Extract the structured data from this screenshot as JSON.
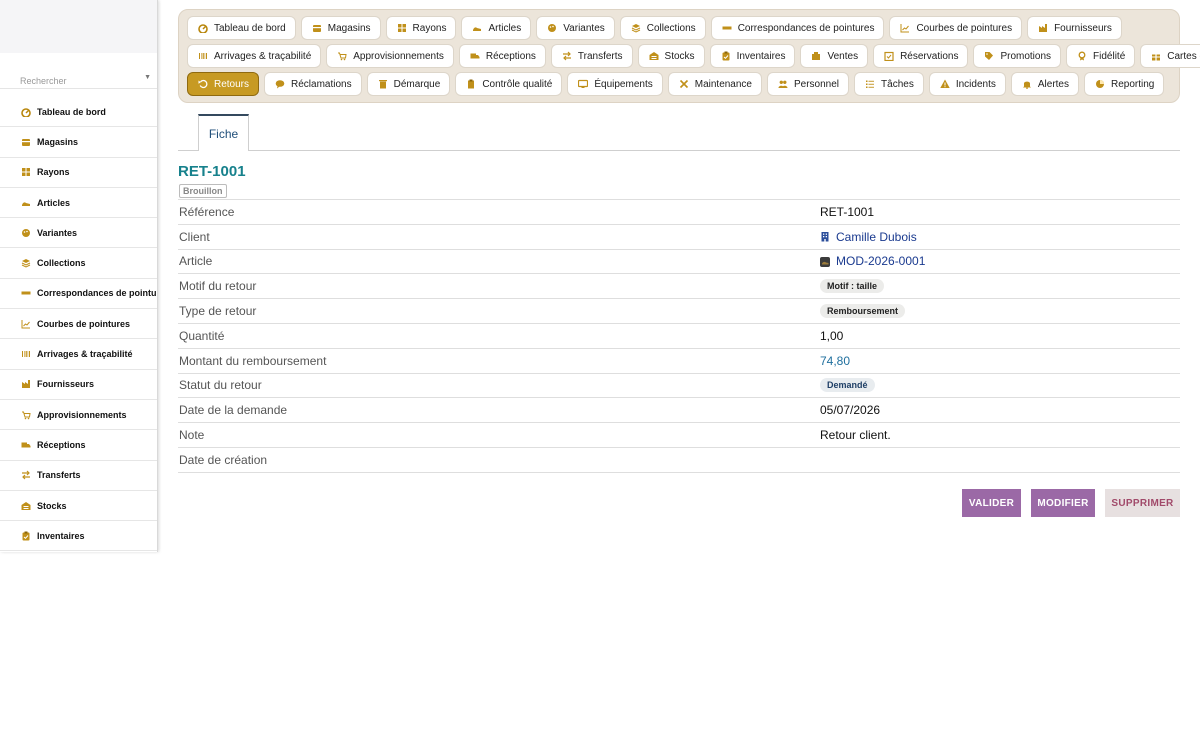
{
  "sidebar": {
    "search_placeholder": "Rechercher",
    "items": [
      {
        "label": "Tableau de bord",
        "icon": "dashboard-icon"
      },
      {
        "label": "Magasins",
        "icon": "store-icon"
      },
      {
        "label": "Rayons",
        "icon": "grid-icon"
      },
      {
        "label": "Articles",
        "icon": "shoe-icon"
      },
      {
        "label": "Variantes",
        "icon": "palette-icon"
      },
      {
        "label": "Collections",
        "icon": "layers-icon"
      },
      {
        "label": "Correspondances de pointures",
        "icon": "ruler-icon"
      },
      {
        "label": "Courbes de pointures",
        "icon": "chart-icon"
      },
      {
        "label": "Arrivages & traçabilité",
        "icon": "barcode-icon"
      },
      {
        "label": "Fournisseurs",
        "icon": "factory-icon"
      },
      {
        "label": "Approvisionnements",
        "icon": "cart-icon"
      },
      {
        "label": "Réceptions",
        "icon": "truck-icon"
      },
      {
        "label": "Transferts",
        "icon": "transfer-icon"
      },
      {
        "label": "Stocks",
        "icon": "warehouse-icon"
      },
      {
        "label": "Inventaires",
        "icon": "clipboard-icon"
      }
    ]
  },
  "topnav": {
    "rows": [
      [
        {
          "label": "Tableau de bord",
          "icon": "dashboard-icon"
        },
        {
          "label": "Magasins",
          "icon": "store-icon"
        },
        {
          "label": "Rayons",
          "icon": "grid-icon"
        },
        {
          "label": "Articles",
          "icon": "shoe-icon"
        },
        {
          "label": "Variantes",
          "icon": "palette-icon"
        },
        {
          "label": "Collections",
          "icon": "layers-icon"
        },
        {
          "label": "Correspondances de pointures",
          "icon": "ruler-icon"
        },
        {
          "label": "Courbes de pointures",
          "icon": "chart-icon"
        },
        {
          "label": "Fournisseurs",
          "icon": "factory-icon"
        }
      ],
      [
        {
          "label": "Arrivages & traçabilité",
          "icon": "barcode-icon"
        },
        {
          "label": "Approvisionnements",
          "icon": "cart-icon"
        },
        {
          "label": "Réceptions",
          "icon": "truck-icon"
        },
        {
          "label": "Transferts",
          "icon": "transfer-icon"
        },
        {
          "label": "Stocks",
          "icon": "warehouse-icon"
        },
        {
          "label": "Inventaires",
          "icon": "clipboard-icon"
        },
        {
          "label": "Ventes",
          "icon": "sales-icon"
        },
        {
          "label": "Réservations",
          "icon": "reservation-icon"
        },
        {
          "label": "Promotions",
          "icon": "tag-icon"
        },
        {
          "label": "Fidélité",
          "icon": "medal-icon"
        },
        {
          "label": "Cartes cadeaux",
          "icon": "gift-icon"
        }
      ],
      [
        {
          "label": "Retours",
          "icon": "undo-icon",
          "active": true
        },
        {
          "label": "Réclamations",
          "icon": "chat-icon"
        },
        {
          "label": "Démarque",
          "icon": "trash-icon"
        },
        {
          "label": "Contrôle qualité",
          "icon": "check-clipboard-icon"
        },
        {
          "label": "Équipements",
          "icon": "monitor-icon"
        },
        {
          "label": "Maintenance",
          "icon": "tools-icon"
        },
        {
          "label": "Personnel",
          "icon": "people-icon"
        },
        {
          "label": "Tâches",
          "icon": "list-icon"
        },
        {
          "label": "Incidents",
          "icon": "warning-icon"
        },
        {
          "label": "Alertes",
          "icon": "bell-icon"
        },
        {
          "label": "Reporting",
          "icon": "pie-icon"
        }
      ]
    ]
  },
  "tabs": {
    "fiche": "Fiche"
  },
  "record": {
    "title": "RET-1001",
    "status": "Brouillon",
    "fields": [
      {
        "label": "Référence",
        "value": "RET-1001",
        "kind": "text"
      },
      {
        "label": "Client",
        "value": "Camille Dubois",
        "kind": "link",
        "icon": "building-icon"
      },
      {
        "label": "Article",
        "value": "MOD-2026-0001",
        "kind": "link",
        "icon": "product-thumb-icon"
      },
      {
        "label": "Motif du retour",
        "value": "Motif : taille",
        "kind": "tag"
      },
      {
        "label": "Type de retour",
        "value": "Remboursement",
        "kind": "tag"
      },
      {
        "label": "Quantité",
        "value": "1,00",
        "kind": "text"
      },
      {
        "label": "Montant du remboursement",
        "value": "74,80",
        "kind": "num-link"
      },
      {
        "label": "Statut du retour",
        "value": "Demandé",
        "kind": "tag-blue"
      },
      {
        "label": "Date de la demande",
        "value": "05/07/2026",
        "kind": "text"
      },
      {
        "label": "Note",
        "value": "Retour client.",
        "kind": "text"
      },
      {
        "label": "Date de création",
        "value": "",
        "kind": "text"
      }
    ]
  },
  "actions": {
    "valider": "VALIDER",
    "modifier": "MODIFIER",
    "supprimer": "SUPPRIMER"
  },
  "colors": {
    "accent": "#c79a23",
    "title": "#17818c",
    "primary_button": "#9b69a6",
    "nav_bg": "#ece5da"
  }
}
